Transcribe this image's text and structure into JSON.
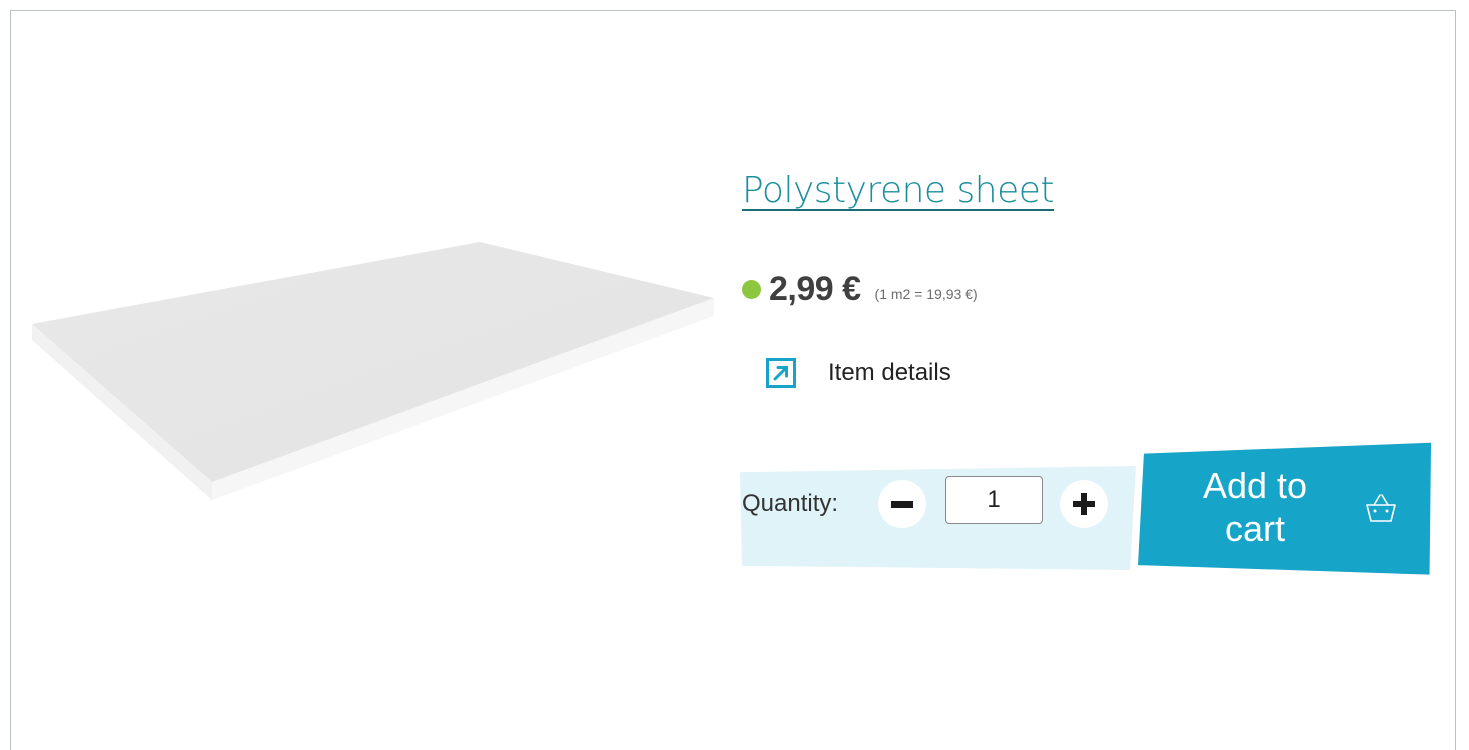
{
  "product": {
    "title": "Polystyrene sheet",
    "price": "2,99 €",
    "unit_price": "(1 m2 = 19,93 €)",
    "stock_status_color": "#8dc63f",
    "image_icon": "polystyrene-sheet-image"
  },
  "details_link": {
    "label": "Item details",
    "icon": "arrow-up-right-icon"
  },
  "quantity": {
    "label": "Quantity:",
    "value": "1",
    "decrement_icon": "minus-icon",
    "increment_icon": "plus-icon"
  },
  "cart": {
    "label": "Add to cart",
    "icon": "basket-icon"
  },
  "colors": {
    "title": "#1a8e9c",
    "accent": "#16a4c8",
    "panel": "#dff3f8",
    "price": "#404040"
  }
}
